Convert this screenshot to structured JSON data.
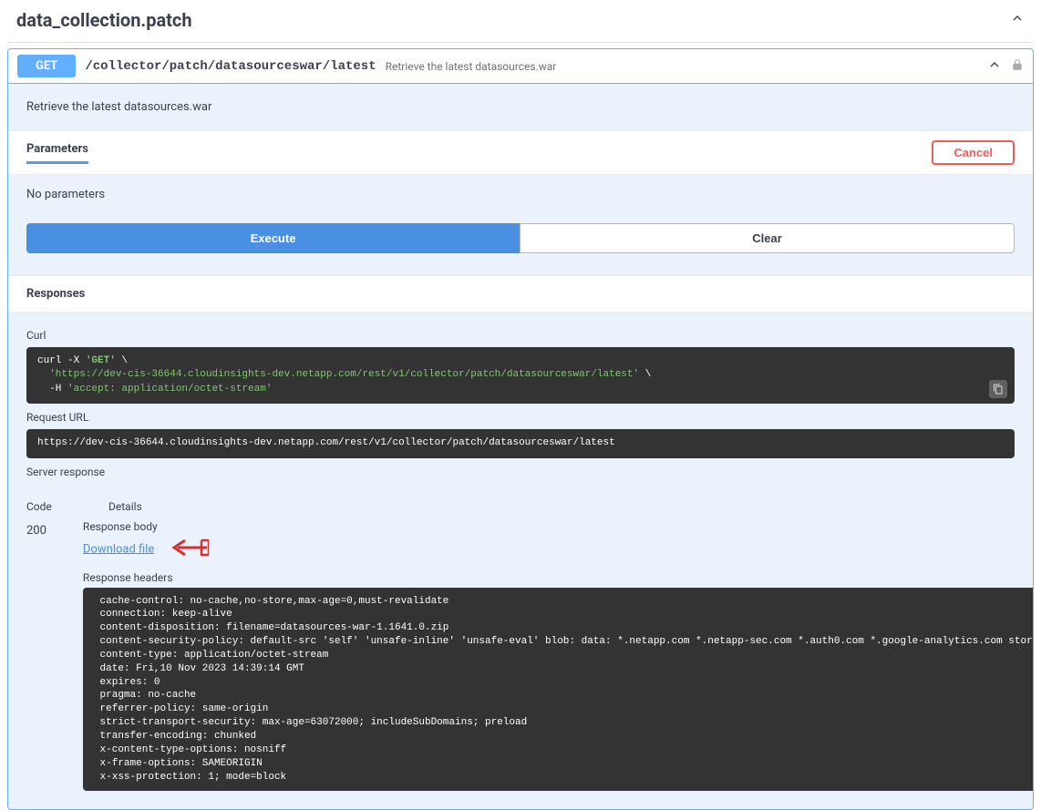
{
  "tag": "data_collection.patch",
  "endpoint": {
    "method": "GET",
    "path": "/collector/patch/datasourceswar/latest",
    "summary": "Retrieve the latest datasources.war"
  },
  "description": "Retrieve the latest datasources.war",
  "params": {
    "title": "Parameters",
    "cancel": "Cancel",
    "none": "No parameters"
  },
  "buttons": {
    "execute": "Execute",
    "clear": "Clear"
  },
  "responses_title": "Responses",
  "curl": {
    "label": "Curl",
    "prefix": "curl -X ",
    "method": "'GET'",
    "slash": " \\",
    "url": "  'https://dev-cis-36644.cloudinsights-dev.netapp.com/rest/v1/collector/patch/datasourceswar/latest'",
    "hflag": "  -H ",
    "header": "'accept: application/octet-stream'"
  },
  "request_url": {
    "label": "Request URL",
    "value": "https://dev-cis-36644.cloudinsights-dev.netapp.com/rest/v1/collector/patch/datasourceswar/latest"
  },
  "server_response_label": "Server response",
  "table": {
    "code": "Code",
    "details": "Details"
  },
  "response": {
    "code": "200",
    "body_label": "Response body",
    "download": "Download file",
    "headers_label": "Response headers",
    "headers": " cache-control: no-cache,no-store,max-age=0,must-revalidate \n connection: keep-alive \n content-disposition: filename=datasources-war-1.1641.0.zip \n content-security-policy: default-src 'self' 'unsafe-inline' 'unsafe-eval' blob: data: *.netapp.com *.netapp-sec.com *.auth0.com *.google-analytics.com storage.googleapis.com *.spotinst.com \n content-type: application/octet-stream \n date: Fri,10 Nov 2023 14:39:14 GMT \n expires: 0 \n pragma: no-cache \n referrer-policy: same-origin \n strict-transport-security: max-age=63072000; includeSubDomains; preload \n transfer-encoding: chunked \n x-content-type-options: nosniff \n x-frame-options: SAMEORIGIN \n x-xss-protection: 1; mode=block "
  }
}
